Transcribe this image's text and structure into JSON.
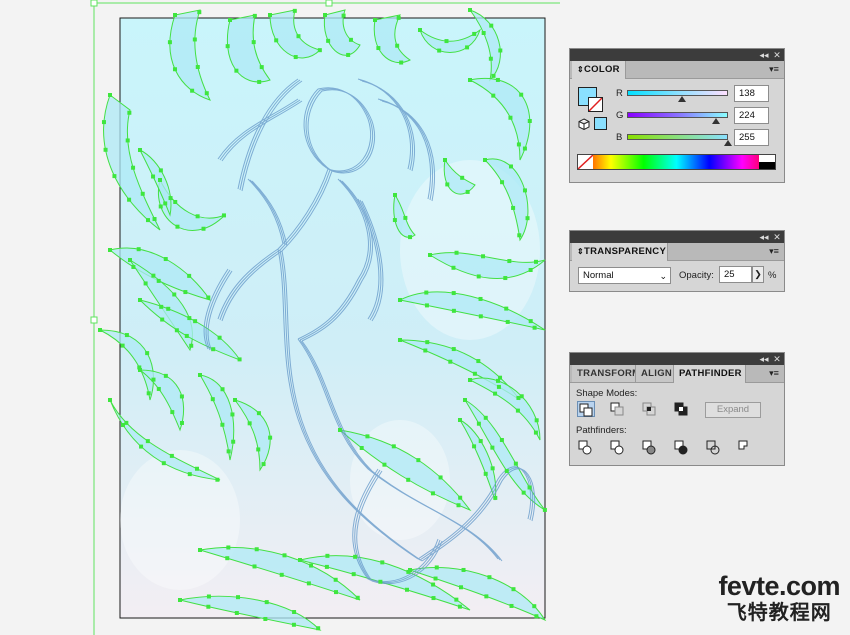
{
  "colors": {
    "canvas_bg": "#f3f3f3",
    "art_fill": "#bff0fa",
    "anchor_green": "#3ee63e",
    "sketch_blue": "#6c9cc8",
    "selected_color": "#8ae0ff"
  },
  "color_panel": {
    "tab_label": "COLOR",
    "channels": [
      {
        "label": "R",
        "value": "138",
        "level": 0.54,
        "gradient": "#00e0ff,#8ae0ff,#ffe0ff"
      },
      {
        "label": "G",
        "value": "224",
        "level": 0.88,
        "gradient": "#8a00ff,#8a70ff,#8affff"
      },
      {
        "label": "B",
        "value": "255",
        "level": 1.0,
        "gradient": "#8ae000,#8ae080,#8ae0ff"
      }
    ],
    "icons": [
      "fill-swatch-icon",
      "stroke-swatch-icon",
      "none-swatch-icon",
      "cube-icon",
      "last-color-icon",
      "spectrum-icon"
    ]
  },
  "transparency_panel": {
    "tab_label": "TRANSPARENCY",
    "blend_mode": "Normal",
    "opacity_label": "Opacity:",
    "opacity_value": "25",
    "percent": "%"
  },
  "pathfinder_panel": {
    "tabs": [
      "TRANSFORM",
      "ALIGN",
      "PATHFINDER"
    ],
    "shape_modes_label": "Shape Modes:",
    "expand_label": "Expand",
    "pathfinders_label": "Pathfinders:",
    "shape_mode_icons": [
      "unite-icon",
      "minus-front-icon",
      "intersect-icon",
      "exclude-icon"
    ],
    "pathfinder_icons": [
      "divide-icon",
      "trim-icon",
      "merge-icon",
      "crop-icon",
      "outline-icon",
      "minus-back-icon"
    ]
  },
  "panel_buttons": {
    "collapse": "◂◂",
    "close": "✕",
    "menu": "▾≡"
  },
  "watermark": {
    "line1": "fevte.com",
    "line2": "飞特教程网"
  }
}
